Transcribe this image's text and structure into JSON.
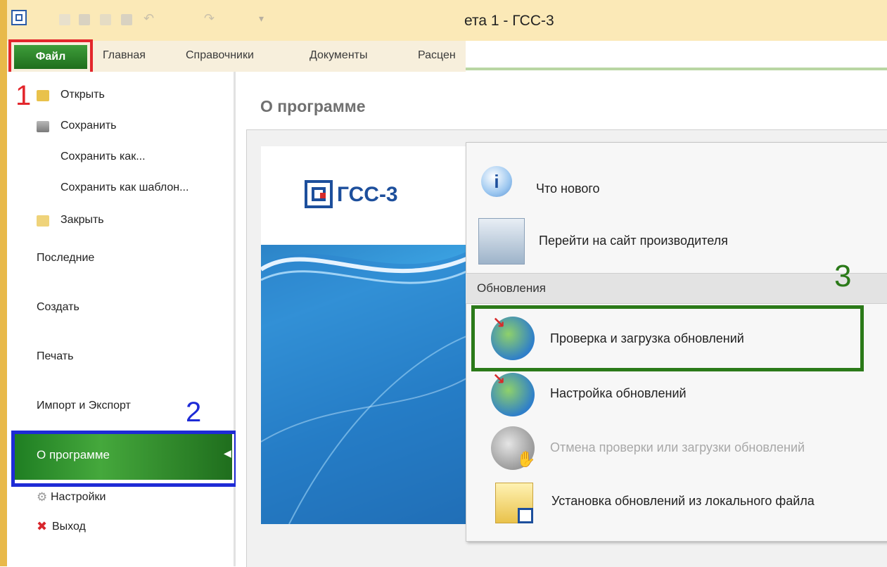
{
  "window": {
    "title": "ета 1 - ГСС-3"
  },
  "tabs": {
    "file": "Файл",
    "home": "Главная",
    "references": "Справочники",
    "documents": "Документы",
    "rates": "Расцен"
  },
  "file_menu": {
    "open": "Открыть",
    "save": "Сохранить",
    "save_as": "Сохранить как...",
    "save_as_template": "Сохранить как шаблон...",
    "close": "Закрыть",
    "recent": "Последние",
    "create": "Создать",
    "print": "Печать",
    "import_export": "Импорт и Экспорт",
    "about": "О программе",
    "settings": "Настройки",
    "exit": "Выход"
  },
  "annotations": {
    "n1": "1",
    "n2": "2",
    "n3": "3"
  },
  "content": {
    "page_title": "О программе",
    "logo_text": "ГСС-3"
  },
  "dropdown": {
    "whats_new": "Что нового",
    "go_to_site": "Перейти на сайт производителя",
    "section": "Обновления",
    "check_updates": "Проверка и загрузка обновлений",
    "update_settings": "Настройка обновлений",
    "cancel_check": "Отмена проверки или загрузки обновлений",
    "install_local": "Установка обновлений из локального файла"
  },
  "colors": {
    "accent_green": "#1f6e1d",
    "annotation_red": "#e3262c",
    "annotation_blue": "#1e2bd6",
    "annotation_green": "#2b7a19"
  }
}
